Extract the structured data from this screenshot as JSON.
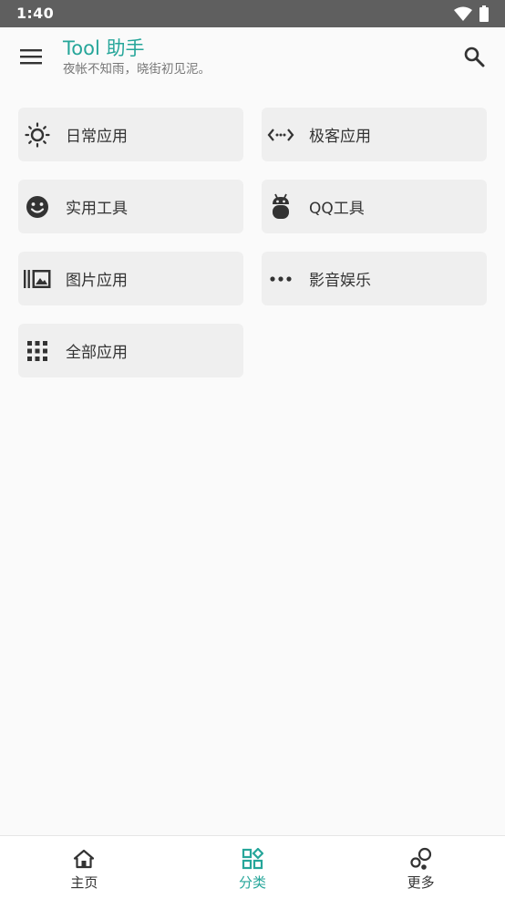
{
  "status_bar": {
    "time": "1:40",
    "icons": [
      "wifi-icon",
      "battery-icon"
    ]
  },
  "app_bar": {
    "title": "Tool 助手",
    "subtitle": "夜帐不知雨，晓街初见泥。",
    "menu_icon": "menu-icon",
    "search_icon": "search-icon",
    "accent_color": "#26a69a"
  },
  "categories": [
    {
      "label": "日常应用",
      "icon": "sun-icon"
    },
    {
      "label": "极客应用",
      "icon": "code-icon"
    },
    {
      "label": "实用工具",
      "icon": "smiley-icon"
    },
    {
      "label": "QQ工具",
      "icon": "android-icon"
    },
    {
      "label": "图片应用",
      "icon": "image-library-icon"
    },
    {
      "label": "影音娱乐",
      "icon": "more-dots-icon"
    },
    {
      "label": "全部应用",
      "icon": "apps-grid-icon"
    }
  ],
  "bottom_nav": {
    "items": [
      {
        "label": "主页",
        "icon": "home-icon",
        "active": false
      },
      {
        "label": "分类",
        "icon": "category-icon",
        "active": true
      },
      {
        "label": "更多",
        "icon": "bubbles-icon",
        "active": false
      }
    ]
  }
}
